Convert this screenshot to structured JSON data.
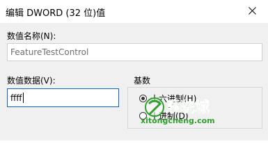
{
  "window": {
    "title": "编辑 DWORD (32 位)值"
  },
  "value_name": {
    "label": "数值名称(N):",
    "value": "FeatureTestControl"
  },
  "value_data": {
    "label": "数值数据(V):",
    "value": "ffff"
  },
  "base": {
    "label": "基数",
    "options": [
      {
        "label": "十六进制(H)",
        "selected": true
      },
      {
        "label": "十进制(D)",
        "selected": false
      }
    ]
  },
  "watermark": {
    "brand": "系统城",
    "site": "xitongcheng.com"
  },
  "colors": {
    "focus_border": "#0a63c7",
    "dialog_bg": "#f0f0f0",
    "watermark": "#2fa12c"
  }
}
